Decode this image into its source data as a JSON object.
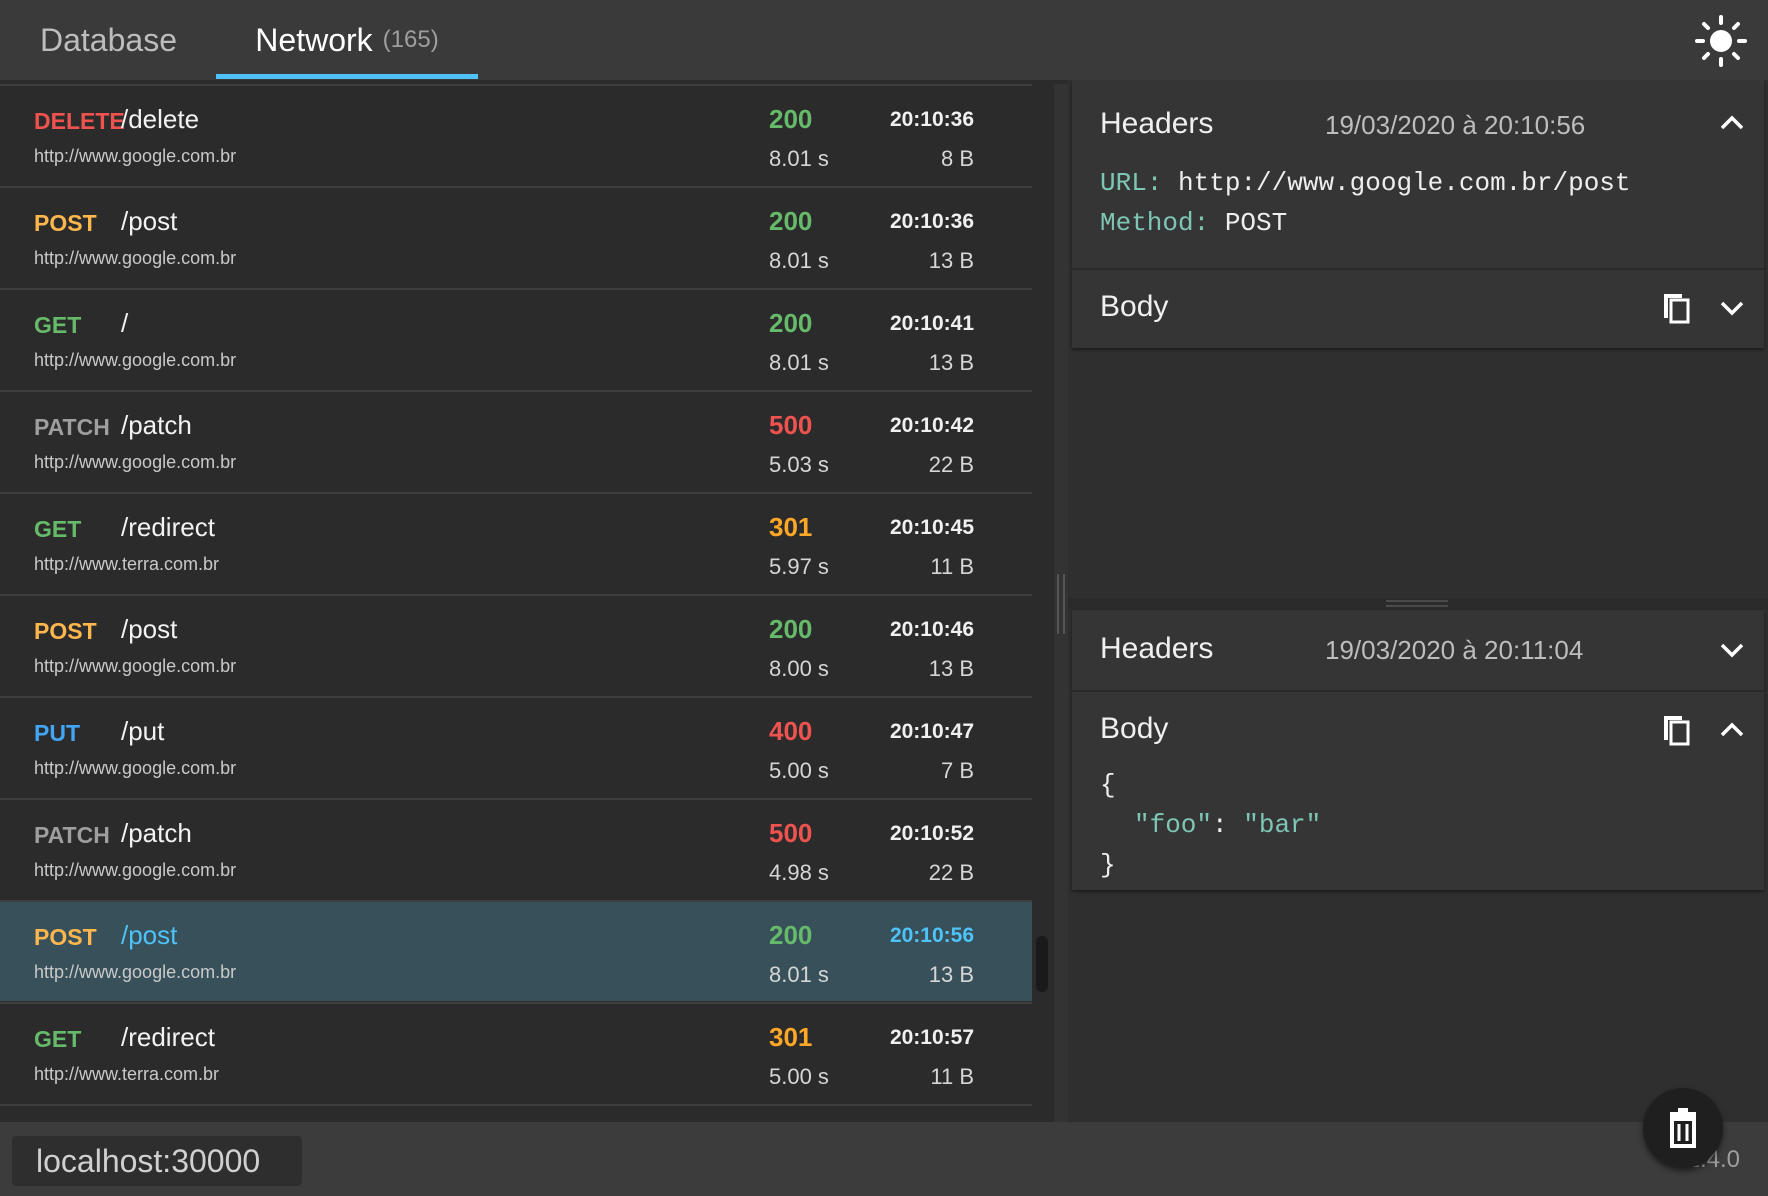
{
  "tabs": {
    "database_label": "Database",
    "network_label": "Network",
    "network_count": "(165)"
  },
  "colors": {
    "accent": "#4fc3f7",
    "delete": "#ef5350",
    "post": "#ffb74d",
    "get": "#66bb6a",
    "patch": "#9e9e9e",
    "put": "#42a5f5"
  },
  "requests": [
    {
      "method": "DELETE",
      "path": "/delete",
      "host": "http://www.google.com.br",
      "status": "200",
      "duration": "8.01 s",
      "time": "20:10:36",
      "size": "8 B"
    },
    {
      "method": "POST",
      "path": "/post",
      "host": "http://www.google.com.br",
      "status": "200",
      "duration": "8.01 s",
      "time": "20:10:36",
      "size": "13 B"
    },
    {
      "method": "GET",
      "path": "/",
      "host": "http://www.google.com.br",
      "status": "200",
      "duration": "8.01 s",
      "time": "20:10:41",
      "size": "13 B"
    },
    {
      "method": "PATCH",
      "path": "/patch",
      "host": "http://www.google.com.br",
      "status": "500",
      "duration": "5.03 s",
      "time": "20:10:42",
      "size": "22 B"
    },
    {
      "method": "GET",
      "path": "/redirect",
      "host": "http://www.terra.com.br",
      "status": "301",
      "duration": "5.97 s",
      "time": "20:10:45",
      "size": "11 B"
    },
    {
      "method": "POST",
      "path": "/post",
      "host": "http://www.google.com.br",
      "status": "200",
      "duration": "8.00 s",
      "time": "20:10:46",
      "size": "13 B"
    },
    {
      "method": "PUT",
      "path": "/put",
      "host": "http://www.google.com.br",
      "status": "400",
      "duration": "5.00 s",
      "time": "20:10:47",
      "size": "7 B"
    },
    {
      "method": "PATCH",
      "path": "/patch",
      "host": "http://www.google.com.br",
      "status": "500",
      "duration": "4.98 s",
      "time": "20:10:52",
      "size": "22 B"
    },
    {
      "method": "POST",
      "path": "/post",
      "host": "http://www.google.com.br",
      "status": "200",
      "duration": "8.01 s",
      "time": "20:10:56",
      "size": "13 B"
    },
    {
      "method": "GET",
      "path": "/redirect",
      "host": "http://www.terra.com.br",
      "status": "301",
      "duration": "5.00 s",
      "time": "20:10:57",
      "size": "11 B"
    }
  ],
  "request_panel": {
    "headers_title": "Headers",
    "date": "19/03/2020 à 20:10:56",
    "url_key": "URL:",
    "url_value": "http://www.google.com.br/post",
    "method_key": "Method:",
    "method_value": "POST",
    "body_title": "Body"
  },
  "response_panel": {
    "headers_title": "Headers",
    "date": "19/03/2020 à 20:11:04",
    "body_title": "Body",
    "body_open": "{",
    "body_key": "\"foo\"",
    "body_colon": ":",
    "body_value": "\"bar\"",
    "body_close": "}"
  },
  "footer": {
    "url": "localhost:30000",
    "version": "v1.4.0"
  },
  "icons": {
    "theme": "sun-icon",
    "copy": "copy-icon",
    "collapse": "chevron-up-icon",
    "expand": "chevron-down-icon",
    "clear": "trash-icon"
  }
}
